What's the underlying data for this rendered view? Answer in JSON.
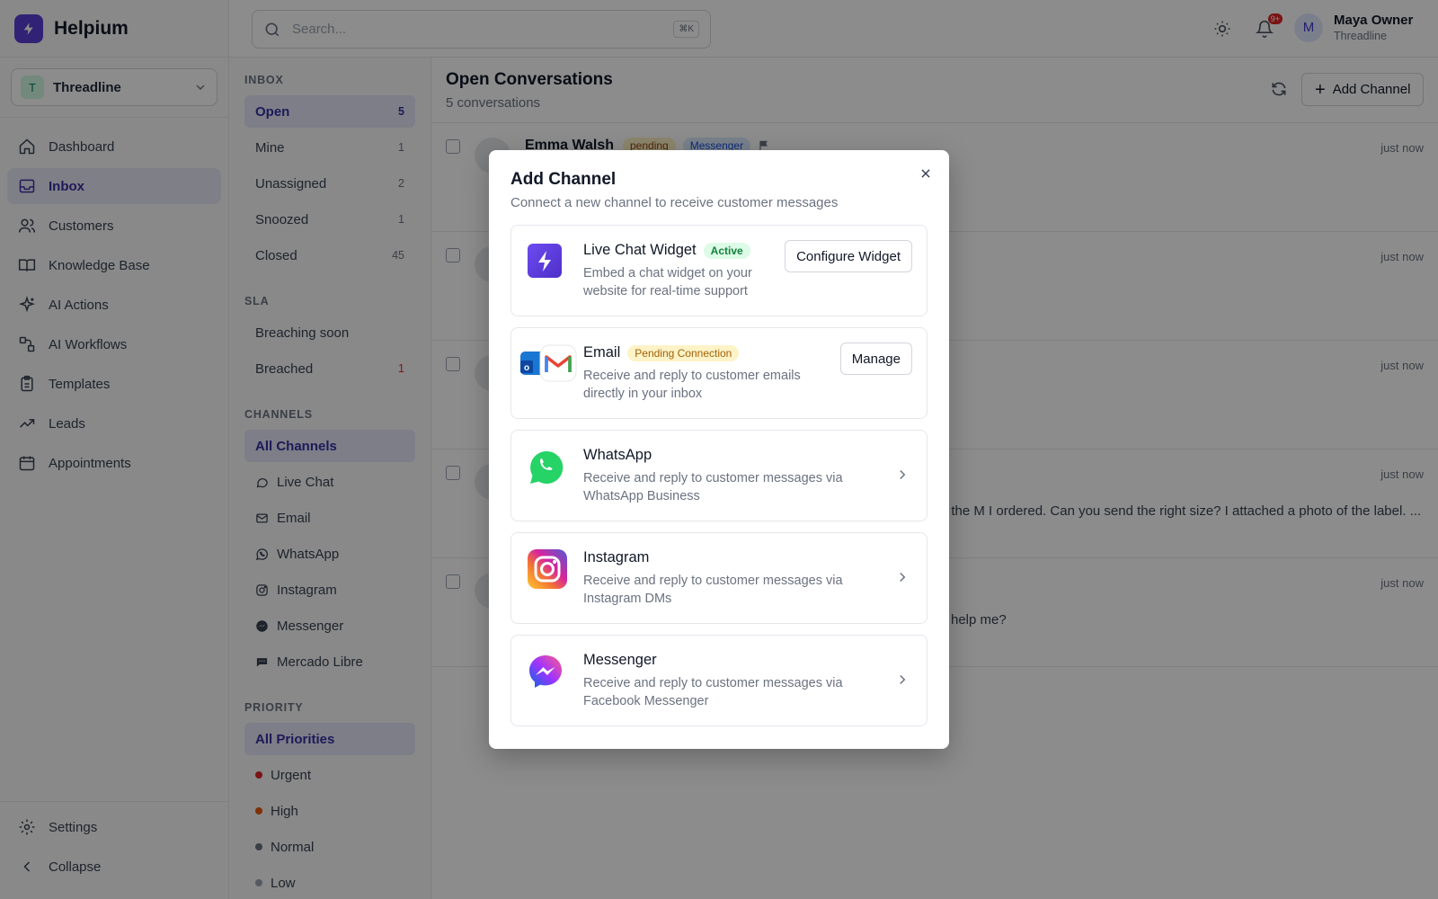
{
  "app": {
    "name": "Helpium"
  },
  "workspace": {
    "name": "Threadline",
    "initial": "T"
  },
  "nav": {
    "items": [
      {
        "label": "Dashboard",
        "icon": "home-icon"
      },
      {
        "label": "Inbox",
        "icon": "inbox-icon",
        "active": true
      },
      {
        "label": "Customers",
        "icon": "users-icon"
      },
      {
        "label": "Knowledge Base",
        "icon": "book-icon"
      },
      {
        "label": "AI Actions",
        "icon": "sparkles-icon"
      },
      {
        "label": "AI Workflows",
        "icon": "workflow-icon"
      },
      {
        "label": "Templates",
        "icon": "clipboard-icon"
      },
      {
        "label": "Leads",
        "icon": "trending-up-icon"
      },
      {
        "label": "Appointments",
        "icon": "calendar-icon"
      }
    ],
    "settings": "Settings",
    "collapse": "Collapse"
  },
  "topbar": {
    "search_placeholder": "Search...",
    "shortcut": "⌘K",
    "notifications": "9+",
    "user_name": "Maya Owner",
    "user_org": "Threadline",
    "user_initial": "M"
  },
  "subnav": {
    "inbox_title": "INBOX",
    "inbox": [
      {
        "label": "Open",
        "count": "5"
      },
      {
        "label": "Mine",
        "count": "1"
      },
      {
        "label": "Unassigned",
        "count": "2"
      },
      {
        "label": "Snoozed",
        "count": "1"
      },
      {
        "label": "Closed",
        "count": "45"
      }
    ],
    "sla_title": "SLA",
    "sla": [
      {
        "label": "Breaching soon",
        "count": ""
      },
      {
        "label": "Breached",
        "count": "1"
      }
    ],
    "channels_title": "CHANNELS",
    "channels": [
      {
        "label": "All Channels"
      },
      {
        "label": "Live Chat"
      },
      {
        "label": "Email"
      },
      {
        "label": "WhatsApp"
      },
      {
        "label": "Instagram"
      },
      {
        "label": "Messenger"
      },
      {
        "label": "Mercado Libre"
      }
    ],
    "priority_title": "PRIORITY",
    "priorities": [
      {
        "label": "All Priorities"
      },
      {
        "label": "Urgent",
        "color": "#dc2626"
      },
      {
        "label": "High",
        "color": "#ea580c"
      },
      {
        "label": "Normal",
        "color": "#6b7280"
      },
      {
        "label": "Low",
        "color": "#9ca3af"
      }
    ]
  },
  "main": {
    "title": "Open Conversations",
    "subtitle": "5 conversations",
    "add_channel": "Add Channel",
    "rows": [
      {
        "name": "Emma Walsh",
        "status": "pending",
        "channel": "Messenger",
        "time": "just now",
        "preview": ""
      },
      {
        "name": "",
        "time": "just now",
        "preview": ""
      },
      {
        "name": "",
        "time": "just now",
        "preview": ""
      },
      {
        "name": "",
        "time": "just now",
        "preview": "f the M I ordered. Can you send the right size? I attached a photo of the label. ..."
      },
      {
        "name": "",
        "time": "just now",
        "preview": "help me?"
      }
    ]
  },
  "modal": {
    "title": "Add Channel",
    "subtitle": "Connect a new channel to receive customer messages",
    "cards": [
      {
        "name": "Live Chat Widget",
        "badge": "Active",
        "desc": "Embed a chat widget on your website for real-time support",
        "button": "Configure Widget"
      },
      {
        "name": "Email",
        "badge": "Pending Connection",
        "desc": "Receive and reply to customer emails directly in your inbox",
        "button": "Manage"
      },
      {
        "name": "WhatsApp",
        "desc": "Receive and reply to customer messages via WhatsApp Business"
      },
      {
        "name": "Instagram",
        "desc": "Receive and reply to customer messages via Instagram DMs"
      },
      {
        "name": "Messenger",
        "desc": "Receive and reply to customer messages via Facebook Messenger"
      }
    ]
  },
  "colors": {
    "brand": "#5b3fd6",
    "accent": "#3730a3",
    "whatsapp": "#25d366",
    "messenger": "#7b4dff"
  }
}
